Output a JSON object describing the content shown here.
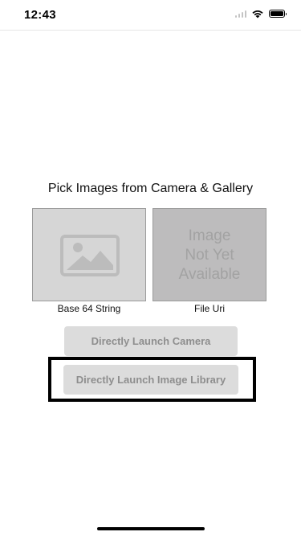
{
  "status_bar": {
    "time": "12:43",
    "icons": [
      "signal-icon",
      "wifi-icon",
      "battery-icon"
    ]
  },
  "main": {
    "heading": "Pick Images from Camera & Gallery",
    "left_box": {
      "icon": "image-placeholder-icon",
      "caption": "Base 64 String"
    },
    "right_box": {
      "placeholder_line1": "Image",
      "placeholder_line2": "Not Yet",
      "placeholder_line3": "Available",
      "caption": "File Uri"
    },
    "buttons": {
      "camera_label": "Directly Launch Camera",
      "library_label": "Directly Launch Image Library"
    }
  },
  "colors": {
    "button_bg": "#dcdcdc",
    "button_text": "#8e8e8e",
    "left_box_bg": "#d6d6d6",
    "right_box_bg": "#bdbcbd",
    "highlight_frame": "#000000"
  }
}
